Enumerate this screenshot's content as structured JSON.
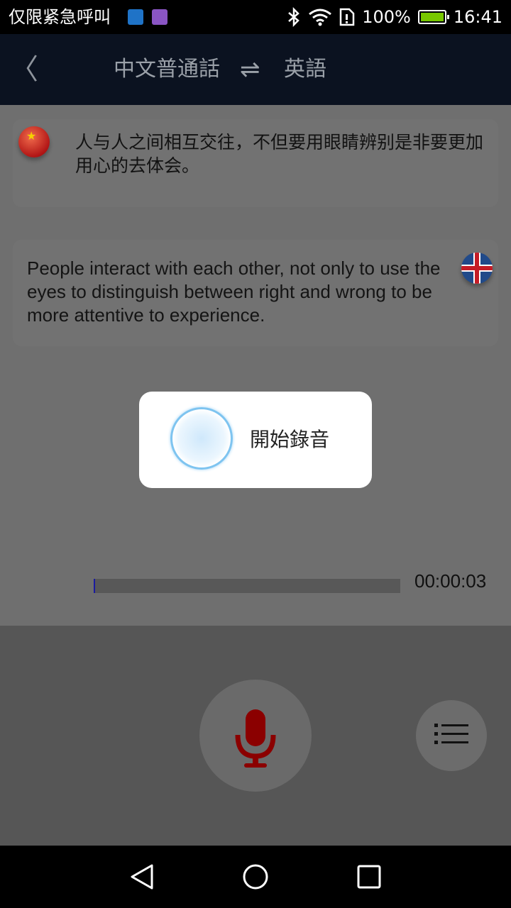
{
  "status_bar": {
    "carrier": "仅限紧急呼叫",
    "battery_percent": "100%",
    "time": "16:41",
    "icons": [
      "usb-icon",
      "image-icon",
      "bluetooth-icon",
      "wifi-icon",
      "sim-alert-icon",
      "battery-charging-icon"
    ]
  },
  "header": {
    "source_language": "中文普通話",
    "target_language": "英語",
    "swap_symbol": "⇌",
    "back_symbol": "〈"
  },
  "conversation": [
    {
      "flag": "china-flag-icon",
      "text": "人与人之间相互交往，不但要用眼睛辨别是非要更加用心的去体会。"
    },
    {
      "flag": "uk-flag-icon",
      "text": "People interact with each other, not only to use the eyes to distinguish between right and wrong to be more attentive to experience."
    }
  ],
  "recording": {
    "dialog_label": "開始錄音",
    "elapsed": "00:00:03",
    "progress_fraction": 0.005
  },
  "colors": {
    "header_bg": "#0b1220",
    "mic_icon": "#8b0000",
    "spinner_ring": "#7ec4f0"
  }
}
